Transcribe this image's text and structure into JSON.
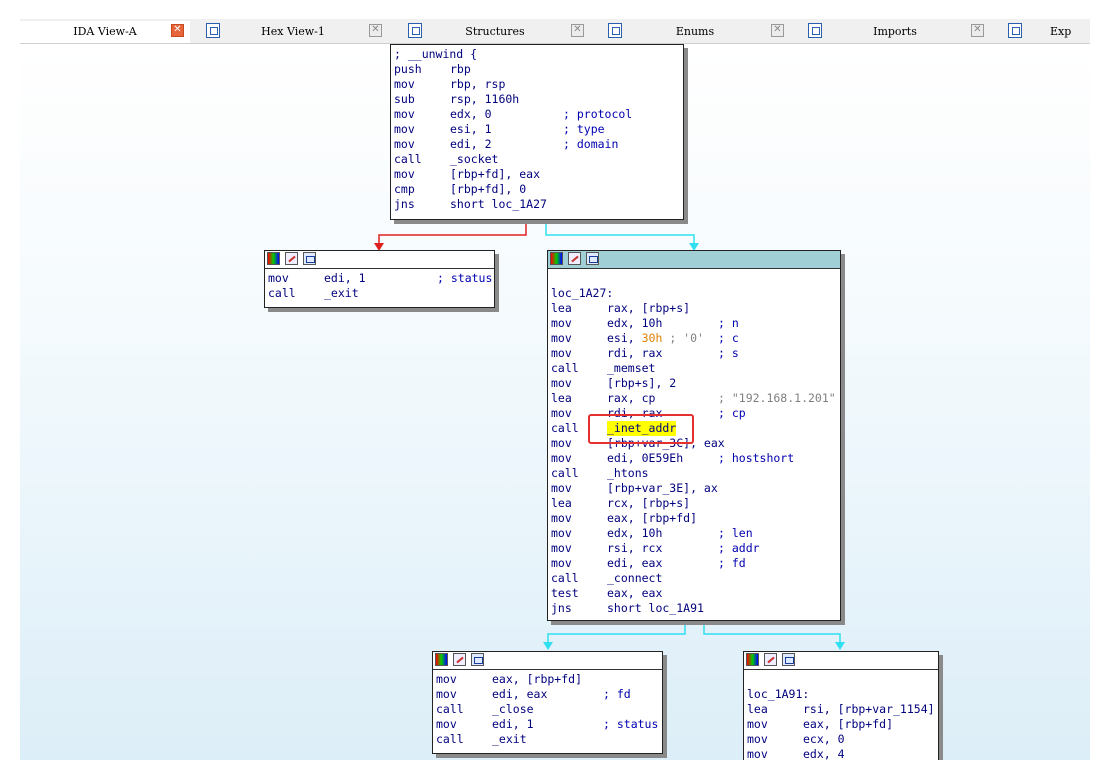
{
  "tabs": [
    {
      "label": "IDA View-A",
      "icon": "ida-view-icon",
      "active": true
    },
    {
      "label": "Hex View-1",
      "icon": "hex-view-icon"
    },
    {
      "label": "Structures",
      "icon": "structures-icon"
    },
    {
      "label": "Enums",
      "icon": "enums-icon"
    },
    {
      "label": "Imports",
      "icon": "imports-icon"
    },
    {
      "label": "Exp",
      "icon": "exports-icon"
    }
  ],
  "colors": {
    "edge_false": "#e02020",
    "edge_true": "#30e0f0",
    "edge_uncond": "#30e0f0",
    "highlight": "#ffff00",
    "callout": "#e53030"
  },
  "nodes": {
    "entry": {
      "lines": [
        {
          "m": "; __unwind {",
          "o": "",
          "c": ""
        },
        {
          "m": "push",
          "o": "rbp",
          "c": ""
        },
        {
          "m": "mov",
          "o": "rbp, rsp",
          "c": ""
        },
        {
          "m": "sub",
          "o": "rsp, 1160h",
          "c": ""
        },
        {
          "m": "mov",
          "o": "edx, 0",
          "c": "; protocol"
        },
        {
          "m": "mov",
          "o": "esi, 1",
          "c": "; type"
        },
        {
          "m": "mov",
          "o": "edi, 2",
          "c": "; domain"
        },
        {
          "m": "call",
          "o": "_socket",
          "c": ""
        },
        {
          "m": "mov",
          "o": "[rbp+fd], eax",
          "c": ""
        },
        {
          "m": "cmp",
          "o": "[rbp+fd], 0",
          "c": ""
        },
        {
          "m": "jns",
          "o": "short loc_1A27",
          "c": ""
        }
      ]
    },
    "exit1": {
      "lines": [
        {
          "m": "mov",
          "o": "edi, 1",
          "c": "; status"
        },
        {
          "m": "call",
          "o": "_exit",
          "c": ""
        }
      ]
    },
    "loc_1A27": {
      "label": "loc_1A27:",
      "lines": [
        {
          "m": "lea",
          "o": "rax, [rbp+s]",
          "c": ""
        },
        {
          "m": "mov",
          "o": "edx, 10h",
          "c": "; n"
        },
        {
          "m": "mov",
          "o": "esi, 30h ; '0'",
          "c": "; c"
        },
        {
          "m": "mov",
          "o": "rdi, rax",
          "c": "; s"
        },
        {
          "m": "call",
          "o": "_memset",
          "c": ""
        },
        {
          "m": "mov",
          "o": "[rbp+s], 2",
          "c": ""
        },
        {
          "m": "lea",
          "o": "rax, cp",
          "c": "; \"192.168.1.201\""
        },
        {
          "m": "mov",
          "o": "rdi, rax",
          "c": "; cp"
        },
        {
          "m": "call",
          "o": "_inet_addr",
          "c": ""
        },
        {
          "m": "mov",
          "o": "[rbp+var_3C], eax",
          "c": ""
        },
        {
          "m": "mov",
          "o": "edi, 0E59Eh",
          "c": "; hostshort"
        },
        {
          "m": "call",
          "o": "_htons",
          "c": ""
        },
        {
          "m": "mov",
          "o": "[rbp+var_3E], ax",
          "c": ""
        },
        {
          "m": "lea",
          "o": "rcx, [rbp+s]",
          "c": ""
        },
        {
          "m": "mov",
          "o": "eax, [rbp+fd]",
          "c": ""
        },
        {
          "m": "mov",
          "o": "edx, 10h",
          "c": "; len"
        },
        {
          "m": "mov",
          "o": "rsi, rcx",
          "c": "; addr"
        },
        {
          "m": "mov",
          "o": "edi, eax",
          "c": "; fd"
        },
        {
          "m": "call",
          "o": "_connect",
          "c": ""
        },
        {
          "m": "test",
          "o": "eax, eax",
          "c": ""
        },
        {
          "m": "jns",
          "o": "short loc_1A91",
          "c": ""
        }
      ]
    },
    "close_exit": {
      "lines": [
        {
          "m": "mov",
          "o": "eax, [rbp+fd]",
          "c": ""
        },
        {
          "m": "mov",
          "o": "edi, eax",
          "c": "; fd"
        },
        {
          "m": "call",
          "o": "_close",
          "c": ""
        },
        {
          "m": "mov",
          "o": "edi, 1",
          "c": "; status"
        },
        {
          "m": "call",
          "o": "_exit",
          "c": ""
        }
      ]
    },
    "loc_1A91": {
      "label": "loc_1A91:",
      "lines": [
        {
          "m": "lea",
          "o": "rsi, [rbp+var_1154]",
          "c": ""
        },
        {
          "m": "mov",
          "o": "eax, [rbp+fd]",
          "c": ""
        },
        {
          "m": "mov",
          "o": "ecx, 0",
          "c": ""
        },
        {
          "m": "mov",
          "o": "edx, 4",
          "c": ""
        }
      ]
    }
  }
}
